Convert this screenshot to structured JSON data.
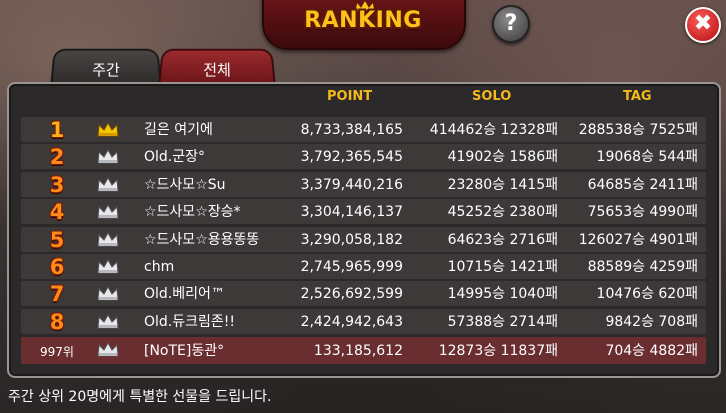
{
  "header": {
    "title": "RANKING",
    "help_label": "?",
    "close_label": "✖"
  },
  "tabs": [
    {
      "label": "주간",
      "selected": false
    },
    {
      "label": "전체",
      "selected": true
    }
  ],
  "columns": {
    "point": "POINT",
    "solo": "SOLO",
    "tag": "TAG"
  },
  "rows": [
    {
      "rank": "1",
      "crown": "gold-crown-icon",
      "name": "길은 여기에",
      "point": "8,733,384,165",
      "solo": "414462승 12328패",
      "tag": "288538승 7525패"
    },
    {
      "rank": "2",
      "crown": "silver-crown-icon",
      "name": "Old.군장°",
      "point": "3,792,365,545",
      "solo": "41902승 1586패",
      "tag": "19068승 544패"
    },
    {
      "rank": "3",
      "crown": "silver-crown-icon",
      "name": "☆드사모☆Su",
      "point": "3,379,440,216",
      "solo": "23280승 1415패",
      "tag": "64685승 2411패"
    },
    {
      "rank": "4",
      "crown": "silver-crown-icon",
      "name": "☆드사모☆장승*",
      "point": "3,304,146,137",
      "solo": "45252승 2380패",
      "tag": "75653승 4990패"
    },
    {
      "rank": "5",
      "crown": "silver-crown-icon",
      "name": "☆드사모☆용용똥똥",
      "point": "3,290,058,182",
      "solo": "64623승 2716패",
      "tag": "126027승 4901패"
    },
    {
      "rank": "6",
      "crown": "silver-crown-icon",
      "name": "chm",
      "point": "2,745,965,999",
      "solo": "10715승 1421패",
      "tag": "88589승 4259패"
    },
    {
      "rank": "7",
      "crown": "silver-crown-icon",
      "name": "Old.베리어™",
      "point": "2,526,692,599",
      "solo": "14995승 1040패",
      "tag": "10476승 620패"
    },
    {
      "rank": "8",
      "crown": "silver-crown-icon",
      "name": "Old.듀크림존!!",
      "point": "2,424,942,643",
      "solo": "57388승 2714패",
      "tag": "9842승 708패"
    }
  ],
  "my_row": {
    "rank": "997위",
    "crown": "silver-crown-icon",
    "name": "[NoTE]동관°",
    "point": "133,185,612",
    "solo": "12873승 11837패",
    "tag": "704승 4882패"
  },
  "footer": {
    "notice": "주간 상위 20명에게 특별한 선물을 드립니다."
  },
  "colors": {
    "accent_gold": "#f5b81c",
    "rank_orange": "#ff8a1a",
    "banner_red": "#6a1418",
    "my_row_bg": "#6a2e30"
  }
}
